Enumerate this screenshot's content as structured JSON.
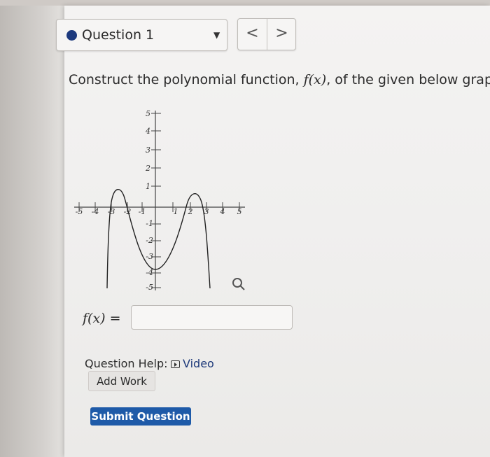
{
  "question_selector": {
    "label": "Question 1"
  },
  "nav": {
    "prev": "<",
    "next": ">"
  },
  "question": {
    "prefix": "Construct the polynomial function, ",
    "func": "f(x)",
    "suffix": ", of the given below graph."
  },
  "graph": {
    "x_tick_labels": [
      "-5",
      "-4",
      "-3",
      "-2",
      "-1",
      "1",
      "2",
      "3",
      "4",
      "5"
    ],
    "y_tick_labels_pos": [
      "1",
      "2",
      "3",
      "4",
      "5"
    ],
    "y_tick_labels_neg": [
      "-1",
      "-2",
      "-3",
      "-4",
      "-5"
    ]
  },
  "answer": {
    "label": "f(x) =",
    "value": ""
  },
  "help": {
    "label": "Question Help:",
    "video": "Video",
    "add_work": "Add Work"
  },
  "submit": {
    "label": "Submit Question"
  }
}
